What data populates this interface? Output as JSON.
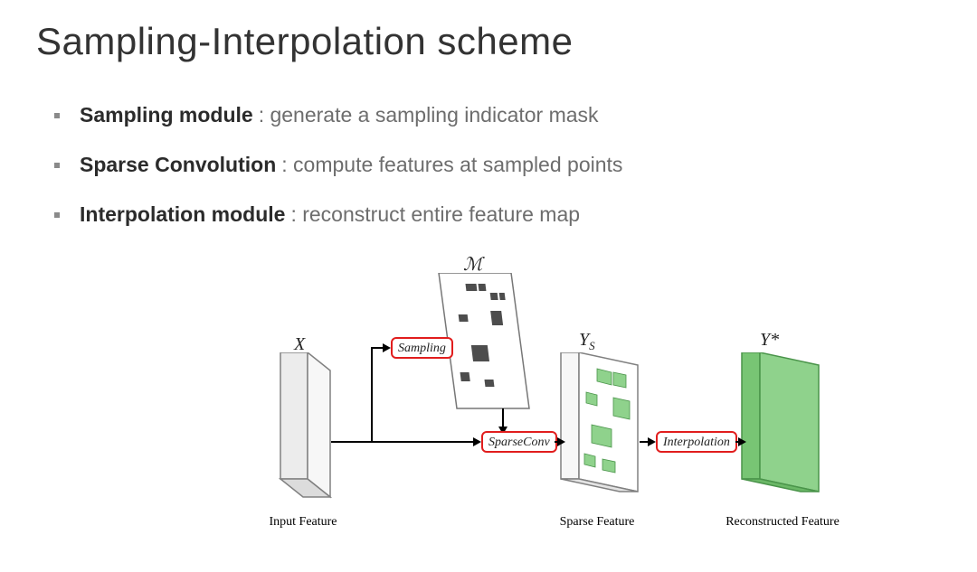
{
  "title": "Sampling-Interpolation scheme",
  "bullets": [
    {
      "label": "Sampling module",
      "desc": ": generate a sampling indicator mask"
    },
    {
      "label": "Sparse Convolution",
      "desc": ": compute features at sampled points"
    },
    {
      "label": "Interpolation module",
      "desc": ": reconstruct entire feature map"
    }
  ],
  "diagram": {
    "blocks": {
      "input": {
        "caption": "Input Feature",
        "top_label": "X"
      },
      "mask": {
        "top_label": "ℳ"
      },
      "sparse": {
        "caption": "Sparse Feature",
        "top_label_html": "Y<span style='font-size:0.65em;font-style:italic;vertical-align:sub'>S</span>"
      },
      "recon": {
        "caption": "Reconstructed Feature",
        "top_label": "Y*"
      }
    },
    "ops": {
      "sampling": "Sampling",
      "sparseconv": "SparseConv",
      "interpolation": "Interpolation"
    },
    "colors": {
      "gray_fill": "#ececec",
      "gray_stroke": "#808080",
      "dark_fill": "#4d4d4d",
      "green_fill": "#8fd28c",
      "green_stroke": "#4a944a",
      "white": "#ffffff"
    }
  }
}
